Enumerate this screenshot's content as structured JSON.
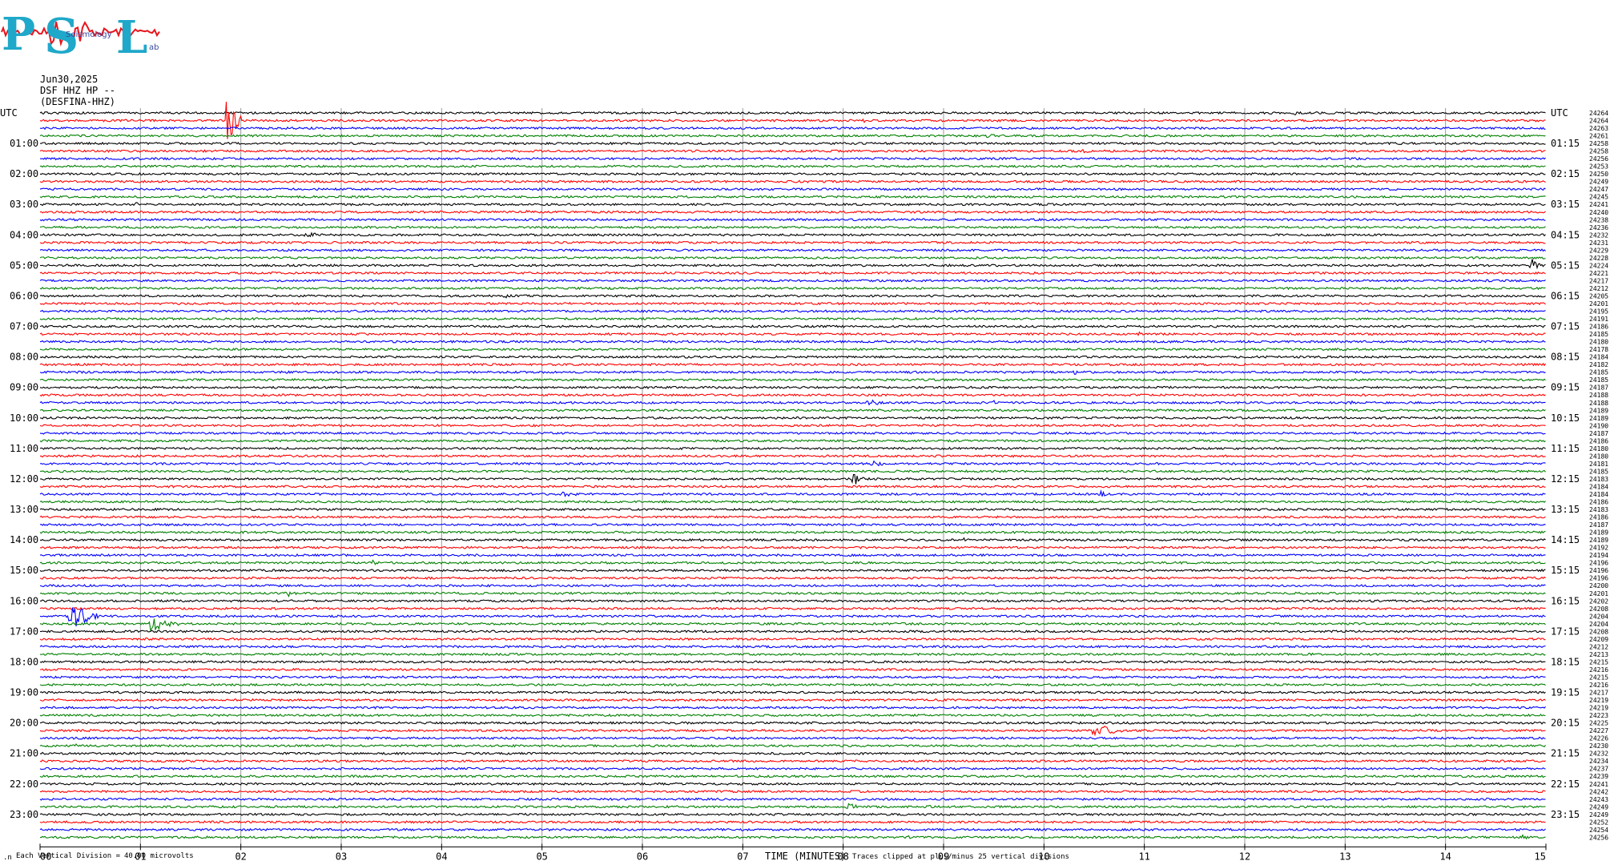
{
  "header": {
    "date": "Jun30,2025",
    "station": "DSF HHZ HP --",
    "channel": "(DESFINA-HHZ)"
  },
  "logo": {
    "letters": [
      "P",
      "S",
      "L"
    ],
    "subtext": "Seismology",
    "subtext2": "ab",
    "colors": {
      "letters": "#1fa8c9",
      "trace": "#e8141c"
    }
  },
  "chart_data": {
    "type": "line",
    "title": "",
    "xlabel": "TIME (MINUTES)",
    "ylabel": "",
    "xlim": [
      0,
      15
    ],
    "x_ticks": [
      "00",
      "01",
      "02",
      "03",
      "04",
      "05",
      "06",
      "07",
      "08",
      "09",
      "10",
      "11",
      "12",
      "13",
      "14",
      "15"
    ],
    "row_count": 96,
    "row_colors": [
      "#000000",
      "#ff0000",
      "#0000ff",
      "#008000"
    ],
    "left_axis_title": "UTC",
    "right_axis_title": "UTC",
    "left_labels": [
      "01:00",
      "02:00",
      "03:00",
      "04:00",
      "05:00",
      "06:00",
      "07:00",
      "08:00",
      "09:00",
      "10:00",
      "11:00",
      "12:00",
      "13:00",
      "14:00",
      "15:00",
      "16:00",
      "17:00",
      "18:00",
      "19:00",
      "20:00",
      "21:00",
      "22:00",
      "23:00"
    ],
    "right_labels": [
      "01:15",
      "02:15",
      "03:15",
      "04:15",
      "05:15",
      "06:15",
      "07:15",
      "08:15",
      "09:15",
      "10:15",
      "11:15",
      "12:15",
      "13:15",
      "14:15",
      "15:15",
      "16:15",
      "17:15",
      "18:15",
      "19:15",
      "20:15",
      "21:15",
      "22:15",
      "23:15"
    ],
    "trace_values": [
      "24264",
      "24264",
      "24263",
      "24261",
      "24258",
      "24258",
      "24256",
      "24253",
      "24250",
      "24249",
      "24247",
      "24245",
      "24241",
      "24240",
      "24238",
      "24236",
      "24232",
      "24231",
      "24229",
      "24228",
      "24224",
      "24221",
      "24217",
      "24212",
      "24205",
      "24201",
      "24195",
      "24191",
      "24186",
      "24185",
      "24180",
      "24178",
      "24184",
      "24182",
      "24185",
      "24185",
      "24187",
      "24188",
      "24188",
      "24189",
      "24189",
      "24190",
      "24187",
      "24186",
      "24180",
      "24180",
      "24181",
      "24185",
      "24183",
      "24184",
      "24184",
      "24186",
      "24183",
      "24186",
      "24187",
      "24189",
      "24189",
      "24192",
      "24194",
      "24196",
      "24196",
      "24196",
      "24200",
      "24201",
      "24202",
      "24208",
      "24204",
      "24204",
      "24208",
      "24209",
      "24212",
      "24213",
      "24215",
      "24216",
      "24215",
      "24216",
      "24217",
      "24219",
      "24219",
      "24223",
      "24225",
      "24227",
      "24226",
      "24230",
      "24232",
      "24234",
      "24237",
      "24239",
      "24241",
      "24242",
      "24243",
      "24249",
      "24249",
      "24252",
      "24254",
      "24256"
    ],
    "events": [
      {
        "row": 1,
        "minute": 1.85,
        "amp": 30,
        "dur": 0.15
      },
      {
        "row": 1,
        "minute": 8.2,
        "amp": 4,
        "dur": 0.05
      },
      {
        "row": 0,
        "minute": 12.5,
        "amp": 4,
        "dur": 0.05
      },
      {
        "row": 3,
        "minute": 9.45,
        "amp": 4,
        "dur": 0.1
      },
      {
        "row": 5,
        "minute": 10.4,
        "amp": 4,
        "dur": 0.1
      },
      {
        "row": 10,
        "minute": 5.9,
        "amp": 3,
        "dur": 0.15
      },
      {
        "row": 12,
        "minute": 0.95,
        "amp": 4,
        "dur": 0.05
      },
      {
        "row": 13,
        "minute": 4.85,
        "amp": 4,
        "dur": 0.05
      },
      {
        "row": 16,
        "minute": 2.65,
        "amp": 4,
        "dur": 0.2
      },
      {
        "row": 20,
        "minute": 14.85,
        "amp": 10,
        "dur": 0.1
      },
      {
        "row": 24,
        "minute": 4.6,
        "amp": 3,
        "dur": 0.2
      },
      {
        "row": 28,
        "minute": 3.3,
        "amp": 3,
        "dur": 0.05
      },
      {
        "row": 29,
        "minute": 10.95,
        "amp": 4,
        "dur": 0.05
      },
      {
        "row": 33,
        "minute": 14.05,
        "amp": 3,
        "dur": 0.1
      },
      {
        "row": 34,
        "minute": 10.3,
        "amp": 4,
        "dur": 0.05
      },
      {
        "row": 38,
        "minute": 8.25,
        "amp": 4,
        "dur": 0.25
      },
      {
        "row": 38,
        "minute": 9.5,
        "amp": 3,
        "dur": 0.2
      },
      {
        "row": 38,
        "minute": 13.0,
        "amp": 3,
        "dur": 0.2
      },
      {
        "row": 43,
        "minute": 14.3,
        "amp": 3,
        "dur": 0.05
      },
      {
        "row": 46,
        "minute": 8.3,
        "amp": 4,
        "dur": 0.2
      },
      {
        "row": 48,
        "minute": 8.1,
        "amp": 10,
        "dur": 0.1
      },
      {
        "row": 50,
        "minute": 5.2,
        "amp": 3,
        "dur": 0.3
      },
      {
        "row": 50,
        "minute": 10.55,
        "amp": 5,
        "dur": 0.1
      },
      {
        "row": 56,
        "minute": 9.2,
        "amp": 3,
        "dur": 0.05
      },
      {
        "row": 59,
        "minute": 3.3,
        "amp": 5,
        "dur": 0.15
      },
      {
        "row": 63,
        "minute": 2.45,
        "amp": 6,
        "dur": 0.1
      },
      {
        "row": 63,
        "minute": 11.45,
        "amp": 4,
        "dur": 0.1
      },
      {
        "row": 66,
        "minute": 0.3,
        "amp": 16,
        "dur": 0.3
      },
      {
        "row": 67,
        "minute": 1.1,
        "amp": 9,
        "dur": 0.3
      },
      {
        "row": 69,
        "minute": 8.25,
        "amp": 3,
        "dur": 0.05
      },
      {
        "row": 74,
        "minute": 3.6,
        "amp": 3,
        "dur": 0.05
      },
      {
        "row": 81,
        "minute": 10.5,
        "amp": 10,
        "dur": 0.3
      },
      {
        "row": 83,
        "minute": 0.35,
        "amp": 3,
        "dur": 0.05
      },
      {
        "row": 91,
        "minute": 8.05,
        "amp": 5,
        "dur": 0.15
      },
      {
        "row": 91,
        "minute": 8.85,
        "amp": 3,
        "dur": 0.05
      },
      {
        "row": 95,
        "minute": 14.75,
        "amp": 4,
        "dur": 0.15
      },
      {
        "row": 95,
        "minute": 8.65,
        "amp": 3,
        "dur": 0.05
      }
    ],
    "grid": true
  },
  "footer": {
    "scale_prefix": "Each Vertical Division =",
    "scale_value": "40.00 microvolts",
    "clip_note": "Traces clipped at plus/minus 25 vertical divisions"
  }
}
